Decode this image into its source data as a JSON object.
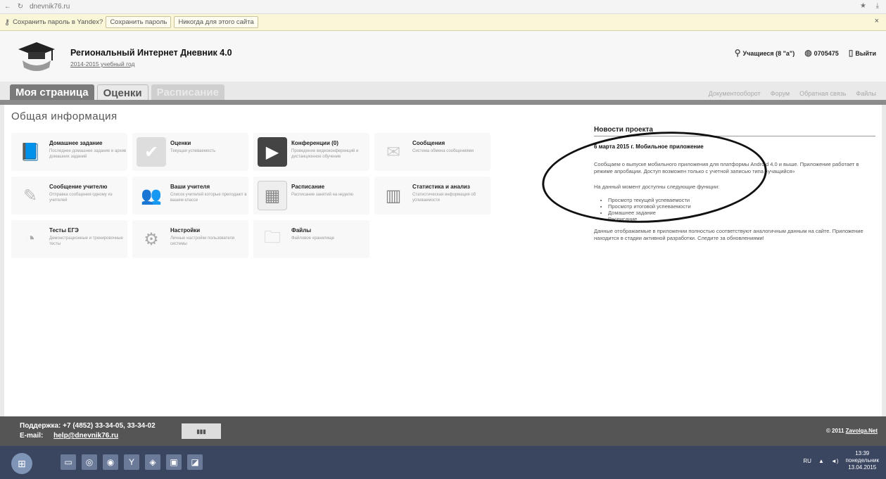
{
  "browser": {
    "url": "dnevnik76.ru",
    "pass_prompt": "Сохранить пароль в Yandex?",
    "pass_save": "Сохранить пароль",
    "pass_never": "Никогда для этого сайта"
  },
  "header": {
    "title": "Региональный Интернет Дневник 4.0",
    "subtitle": "2014-2015 учебный год",
    "user": "Учащиеся (8 \"а\")",
    "user_id": "0705475",
    "logout": "Выйти"
  },
  "tabs": [
    "Моя страница",
    "Оценки",
    "Расписание"
  ],
  "top_links": [
    "Документооборот",
    "Форум",
    "Обратная связь",
    "Файлы"
  ],
  "main": {
    "title": "Общая информация",
    "cards": [
      {
        "title": "Домашнее задание",
        "desc": "Последнее домашнее задание и архив домашних заданий",
        "icon": "book-icon"
      },
      {
        "title": "Оценки",
        "desc": "Текущая успеваемость",
        "icon": "check-icon"
      },
      {
        "title": "Конференции (0)",
        "desc": "Проведение видеоконференций и дистанционное обучение",
        "icon": "video-icon"
      },
      {
        "title": "Сообщения",
        "desc": "Система обмена сообщениями",
        "icon": "mail-icon"
      },
      {
        "title": "Сообщение учителю",
        "desc": "Отправка сообщения одному из учителей",
        "icon": "pencil-icon"
      },
      {
        "title": "Ваши учителя",
        "desc": "Список учителей которые преподают в вашем классе",
        "icon": "people-icon"
      },
      {
        "title": "Расписание",
        "desc": "Расписание занятий на неделю",
        "icon": "calendar-icon"
      },
      {
        "title": "Статистика и анализ",
        "desc": "Статистическая информация об успеваемости",
        "icon": "chart-icon"
      },
      {
        "title": "Тесты ЕГЭ",
        "desc": "Демонстрационные и тренировочные тесты",
        "icon": "test-icon"
      },
      {
        "title": "Настройки",
        "desc": "Личные настройки пользователя системы",
        "icon": "gear-icon"
      },
      {
        "title": "Файлы",
        "desc": "Файловое хранилище",
        "icon": "folder-icon"
      }
    ]
  },
  "news": {
    "title": "Новости проекта",
    "date": "6 марта 2015 г.  Мобильное приложение",
    "p1": "Сообщаем о выпуске мобильного приложения для платформы Android 4.0 и выше. Приложение работает в режиме апробации. Доступ возможен только с учетной записью типа «учащийся»",
    "p2": "На данный момент доступны следующие функции:",
    "items": [
      "Просмотр текущей успеваемости",
      "Просмотр итоговой успеваемости",
      "Домашнее задание",
      "Расписание"
    ],
    "p3": "Данные отображаемые в приложении полностью соответствуют аналогичным данным на сайте. Приложение находится в стадии активной разработки. Следите за обновлениями!"
  },
  "footer": {
    "support": "Поддержка: +7 (4852) 33-34-05, 33-34-02",
    "email_label": "E-mail:",
    "email": "help@dnevnik76.ru",
    "copyright_prefix": "© 2011",
    "copyright_link": "Zavolga.Net"
  },
  "taskbar": {
    "lang": "RU",
    "time": "13:39",
    "day": "понедельник",
    "date": "13.04.2015"
  }
}
